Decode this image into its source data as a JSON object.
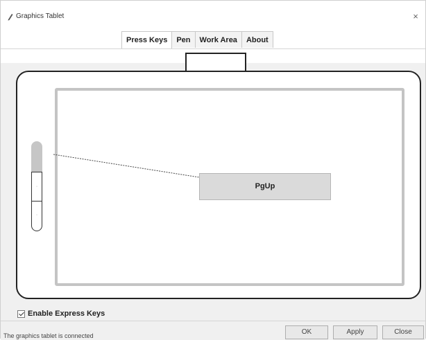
{
  "window": {
    "title": "Graphics Tablet",
    "close_glyph": "×"
  },
  "tabs": [
    {
      "label": "Press Keys",
      "active": true
    },
    {
      "label": "Pen",
      "active": false
    },
    {
      "label": "Work Area",
      "active": false
    },
    {
      "label": "About",
      "active": false
    }
  ],
  "tablet": {
    "side_keys": [
      "·",
      "·"
    ],
    "selected_key_assignment": "PgUp"
  },
  "express_keys": {
    "label": "Enable Express Keys",
    "checked": true
  },
  "status": {
    "text": "The graphics tablet is connected"
  },
  "buttons": {
    "ok": "OK",
    "apply": "Apply",
    "close": "Close"
  },
  "icons": {
    "app": "pen-icon",
    "close": "close-icon",
    "check": "checkmark-icon"
  }
}
